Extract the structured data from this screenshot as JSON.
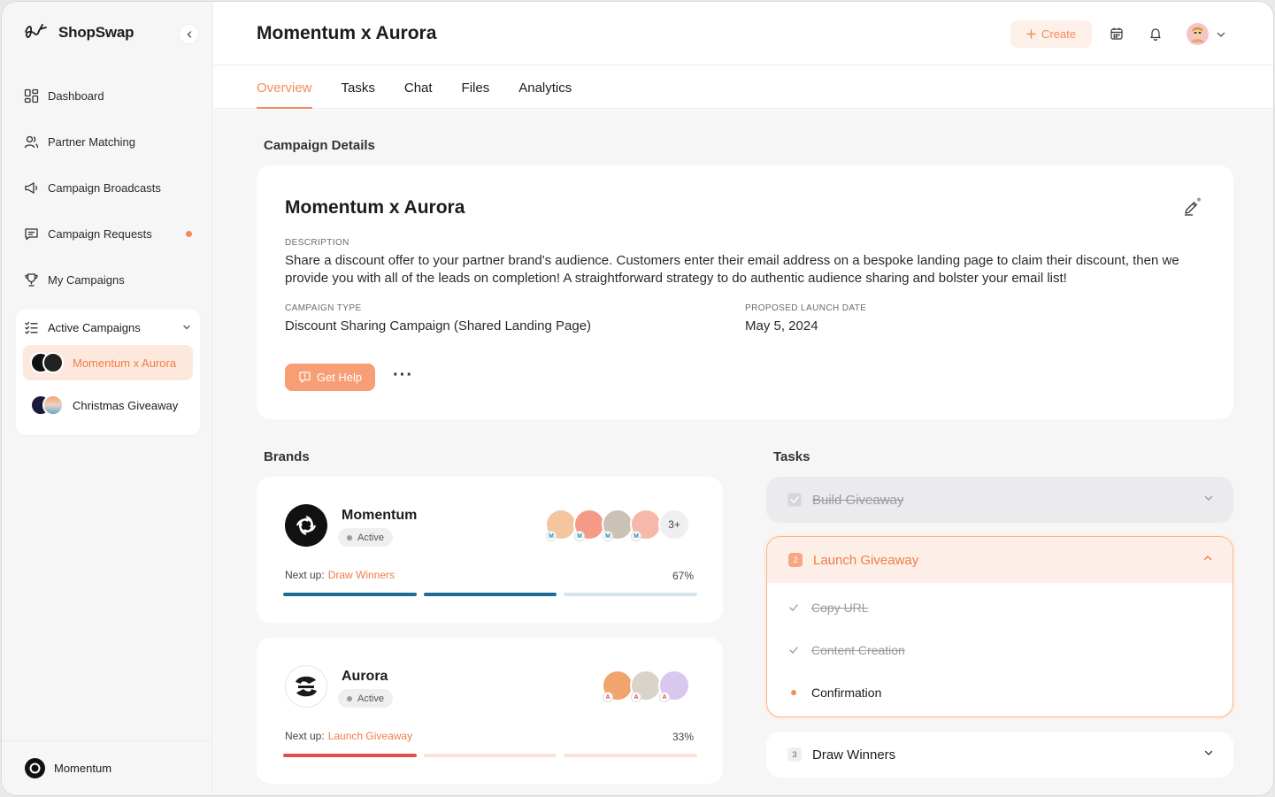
{
  "app": {
    "name": "ShopSwap"
  },
  "sidebar": {
    "items": [
      {
        "label": "Dashboard",
        "icon": "dashboard-icon"
      },
      {
        "label": "Partner Matching",
        "icon": "users-icon"
      },
      {
        "label": "Campaign Broadcasts",
        "icon": "megaphone-icon"
      },
      {
        "label": "Campaign Requests",
        "icon": "message-icon",
        "notification": true
      },
      {
        "label": "My Campaigns",
        "icon": "trophy-icon"
      }
    ],
    "active_campaigns": {
      "label": "Active Campaigns",
      "campaigns": [
        {
          "label": "Momentum x Aurora",
          "selected": true
        },
        {
          "label": "Christmas Giveaway",
          "selected": false
        }
      ]
    },
    "footer": {
      "account": "Momentum"
    }
  },
  "header": {
    "title": "Momentum x Aurora",
    "create_label": "Create"
  },
  "tabs": [
    {
      "label": "Overview",
      "active": true
    },
    {
      "label": "Tasks",
      "active": false
    },
    {
      "label": "Chat",
      "active": false
    },
    {
      "label": "Files",
      "active": false
    },
    {
      "label": "Analytics",
      "active": false
    }
  ],
  "campaign_details": {
    "section_title": "Campaign Details",
    "title": "Momentum x Aurora",
    "description_label": "DESCRIPTION",
    "description": "Share a discount offer to your partner brand's audience. Customers enter their email address on a bespoke landing page to claim their discount, then we provide you with all of the leads on completion! A straightforward strategy to do authentic audience sharing and bolster your email list!",
    "type_label": "CAMPAIGN TYPE",
    "type": "Discount Sharing Campaign (Shared Landing Page)",
    "date_label": "PROPOSED LAUNCH DATE",
    "date": "May 5, 2024",
    "help_label": "Get Help",
    "more_label": "···"
  },
  "brands": {
    "section_title": "Brands",
    "next_up_label": "Next up:",
    "list": [
      {
        "name": "Momentum",
        "status": "Active",
        "next_task": "Draw Winners",
        "progress_label": "67%",
        "progress": 0.67,
        "member_initial": "M",
        "more_members": "3+",
        "bar_color": "#1f6b93",
        "bar_track": "#d7e6ee"
      },
      {
        "name": "Aurora",
        "status": "Active",
        "next_task": "Launch Giveaway",
        "progress_label": "33%",
        "progress": 0.33,
        "member_initial": "A",
        "bar_color": "#e2504c",
        "bar_track": "#fbe1d9"
      }
    ]
  },
  "tasks": {
    "section_title": "Tasks",
    "items": [
      {
        "number": "",
        "label": "Build Giveaway",
        "state": "done"
      },
      {
        "number": "2",
        "label": "Launch Giveaway",
        "state": "active",
        "subtasks": [
          {
            "label": "Copy URL",
            "done": true
          },
          {
            "label": "Content Creation",
            "done": true
          },
          {
            "label": "Confirmation",
            "done": false
          }
        ]
      },
      {
        "number": "3",
        "label": "Draw Winners",
        "state": "pending"
      }
    ]
  },
  "colors": {
    "accent": "#f28d5b",
    "accent_light": "#fdf0e9",
    "background": "#f6f6f7"
  }
}
